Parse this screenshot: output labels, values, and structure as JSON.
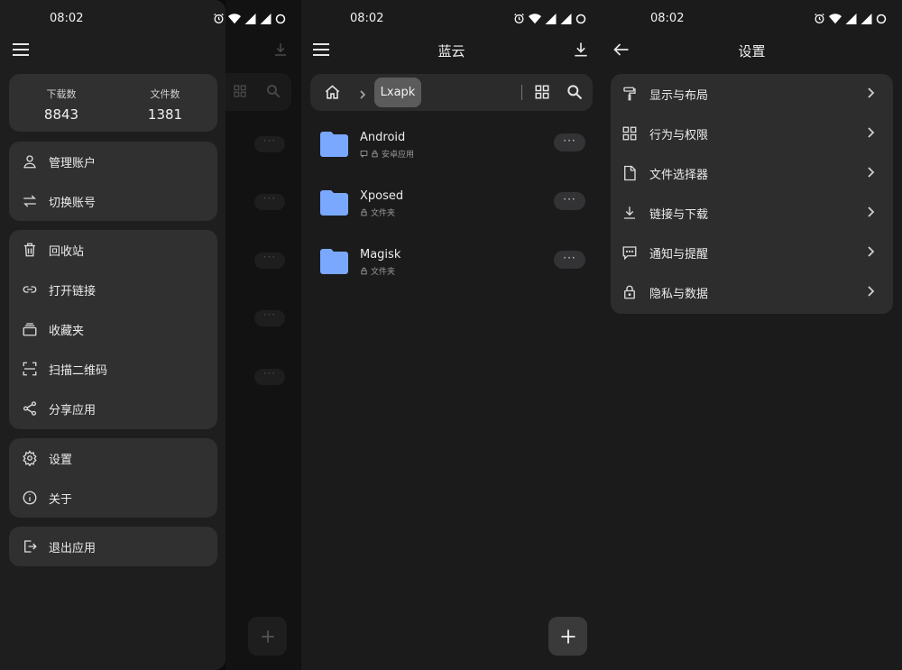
{
  "status_bar": {
    "time": "08:02"
  },
  "drawer": {
    "stats": [
      {
        "label": "下载数",
        "value": "8843"
      },
      {
        "label": "文件数",
        "value": "1381"
      }
    ],
    "account_items": [
      {
        "label": "管理账户",
        "icon": "person-icon"
      },
      {
        "label": "切换账号",
        "icon": "swap-icon"
      }
    ],
    "tool_items": [
      {
        "label": "回收站",
        "icon": "trash-icon"
      },
      {
        "label": "打开链接",
        "icon": "link-icon"
      },
      {
        "label": "收藏夹",
        "icon": "collection-icon"
      },
      {
        "label": "扫描二维码",
        "icon": "scan-icon"
      },
      {
        "label": "分享应用",
        "icon": "share-icon"
      }
    ],
    "app_items": [
      {
        "label": "设置",
        "icon": "gear-icon"
      },
      {
        "label": "关于",
        "icon": "info-icon"
      }
    ],
    "exit_item": {
      "label": "退出应用",
      "icon": "exit-icon"
    }
  },
  "browser": {
    "title": "蓝云",
    "breadcrumb": {
      "current": "Lxapk"
    },
    "folders": [
      {
        "name": "Android",
        "meta": "安卓应用",
        "extra_icon": "comment-icon"
      },
      {
        "name": "Xposed",
        "meta": "文件夹"
      },
      {
        "name": "Magisk",
        "meta": "文件夹"
      }
    ],
    "accent_color": "#7aa8ff"
  },
  "settings": {
    "title": "设置",
    "items": [
      {
        "label": "显示与布局",
        "icon": "paint-roller-icon"
      },
      {
        "label": "行为与权限",
        "icon": "grid-icon"
      },
      {
        "label": "文件选择器",
        "icon": "file-icon"
      },
      {
        "label": "链接与下载",
        "icon": "download-icon"
      },
      {
        "label": "通知与提醒",
        "icon": "message-icon"
      },
      {
        "label": "隐私与数据",
        "icon": "lock-icon"
      }
    ]
  }
}
